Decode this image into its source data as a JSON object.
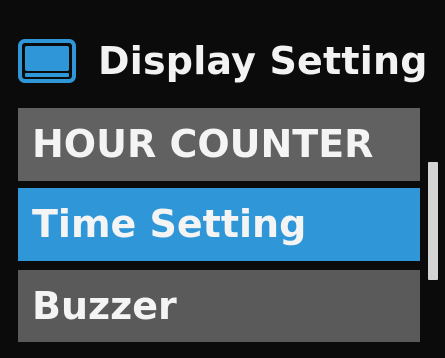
{
  "header": {
    "icon": "display-icon",
    "title": "Display Setting"
  },
  "menu": {
    "selected_index": 1,
    "items": [
      {
        "label": "HOUR COUNTER"
      },
      {
        "label": "Time Setting"
      },
      {
        "label": "Buzzer"
      }
    ]
  },
  "colors": {
    "background": "#0b0b0b",
    "item": "#616161",
    "selected": "#2f96d8",
    "icon": "#2f96d8",
    "text": "#f4f4f4",
    "scroll_thumb": "#d4d4d4"
  }
}
